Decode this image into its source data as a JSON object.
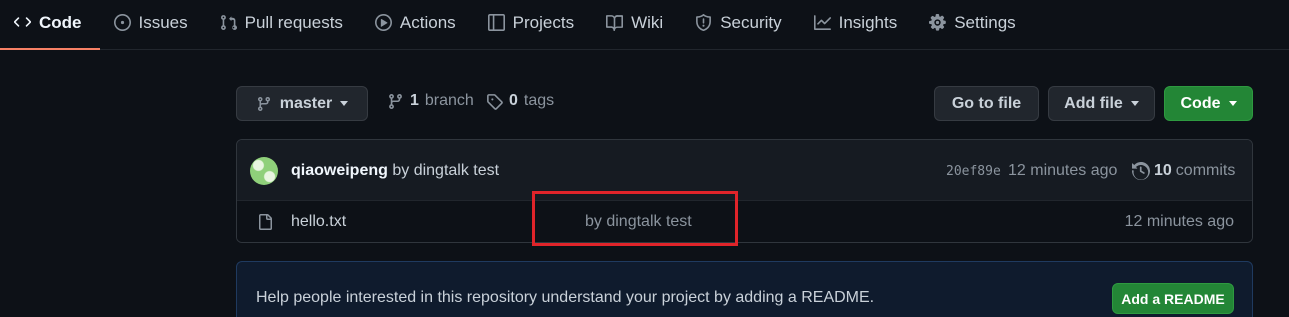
{
  "tabs": [
    {
      "label": "Code",
      "icon": "code-icon",
      "active": true
    },
    {
      "label": "Issues",
      "icon": "issue-icon"
    },
    {
      "label": "Pull requests",
      "icon": "pull-request-icon"
    },
    {
      "label": "Actions",
      "icon": "play-icon"
    },
    {
      "label": "Projects",
      "icon": "table-icon"
    },
    {
      "label": "Wiki",
      "icon": "book-icon"
    },
    {
      "label": "Security",
      "icon": "shield-icon"
    },
    {
      "label": "Insights",
      "icon": "graph-icon"
    },
    {
      "label": "Settings",
      "icon": "gear-icon"
    }
  ],
  "repo_nav": {
    "branch_button": "master",
    "branches": {
      "count": "1",
      "label": "branch"
    },
    "tags": {
      "count": "0",
      "label": "tags"
    },
    "go_to_file": "Go to file",
    "add_file": "Add file",
    "code_button": "Code"
  },
  "latest_commit": {
    "author": "qiaoweipeng",
    "message": "by dingtalk test",
    "sha": "20ef89e",
    "age": "12 minutes ago",
    "commits_count": "10",
    "commits_label": "commits"
  },
  "files": [
    {
      "name": "hello.txt",
      "message": "by dingtalk test",
      "age": "12 minutes ago"
    }
  ],
  "readme_prompt": {
    "text": "Help people interested in this repository understand your project by adding a README.",
    "button": "Add a README"
  },
  "colors": {
    "background": "#0d1117",
    "accent_tab": "#f78166",
    "green_button": "#238636",
    "highlight_box": "#e0242a"
  }
}
